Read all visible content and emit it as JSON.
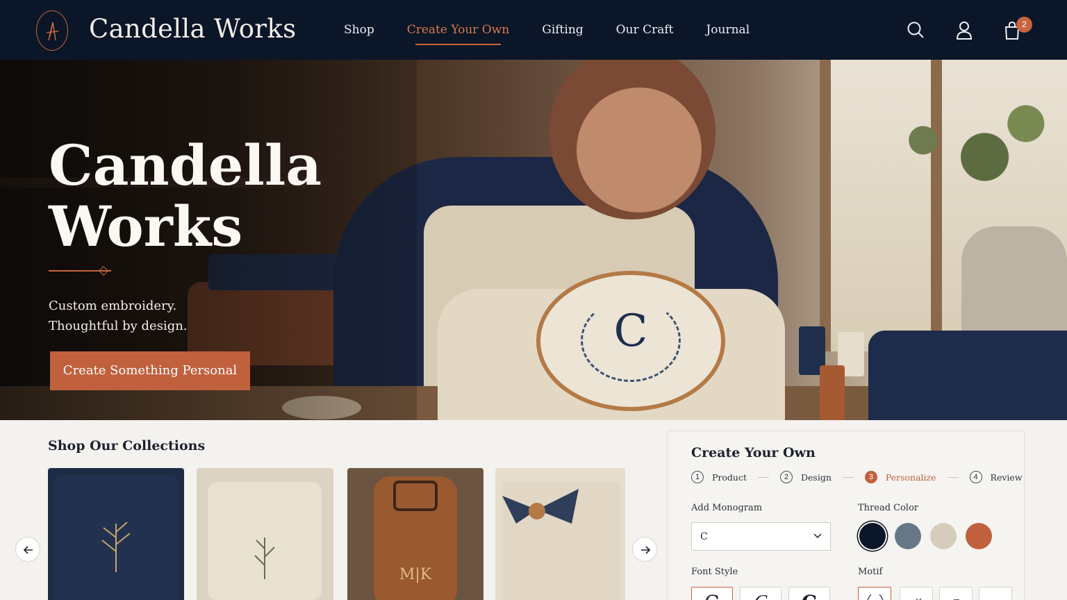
{
  "brand": {
    "name": "Candella Works"
  },
  "nav": {
    "links": [
      {
        "label": "Shop"
      },
      {
        "label": "Create Your Own"
      },
      {
        "label": "Gifting"
      },
      {
        "label": "Our Craft"
      },
      {
        "label": "Journal"
      }
    ],
    "active_index": 1,
    "icons": [
      "search-icon",
      "account-icon",
      "cart-icon"
    ],
    "cart_count": "2"
  },
  "hero": {
    "title_line1": "Candella",
    "title_line2": "Works",
    "tagline_line1": "Custom embroidery.",
    "tagline_line2": "Thoughtful by design.",
    "cta_label": "Create Something Personal",
    "hoop_letter": "C"
  },
  "collections": {
    "title": "Shop Our Collections",
    "cards": [
      {
        "name": "navy-embroidered-pouch"
      },
      {
        "name": "linen-zip-pouch"
      },
      {
        "name": "leather-luggage-tag",
        "monogram": "M|K"
      },
      {
        "name": "gift-wrapped-box"
      }
    ]
  },
  "create": {
    "title": "Create Your Own",
    "steps": [
      {
        "num": "1",
        "label": "Product"
      },
      {
        "num": "2",
        "label": "Design"
      },
      {
        "num": "3",
        "label": "Personalize"
      },
      {
        "num": "4",
        "label": "Review"
      }
    ],
    "active_step": 3,
    "monogram_label": "Add Monogram",
    "monogram_value": "C",
    "thread_label": "Thread Color",
    "thread_colors": [
      "#0b1628",
      "#667787",
      "#d6ccbd",
      "#c0603d"
    ],
    "thread_selected": 0,
    "font_label": "Font Style",
    "font_options": [
      "C",
      "C",
      "C"
    ],
    "motif_label": "Motif"
  },
  "colors": {
    "navy": "#0b1628",
    "accent": "#c0603d",
    "cream": "#f4f2ee"
  }
}
